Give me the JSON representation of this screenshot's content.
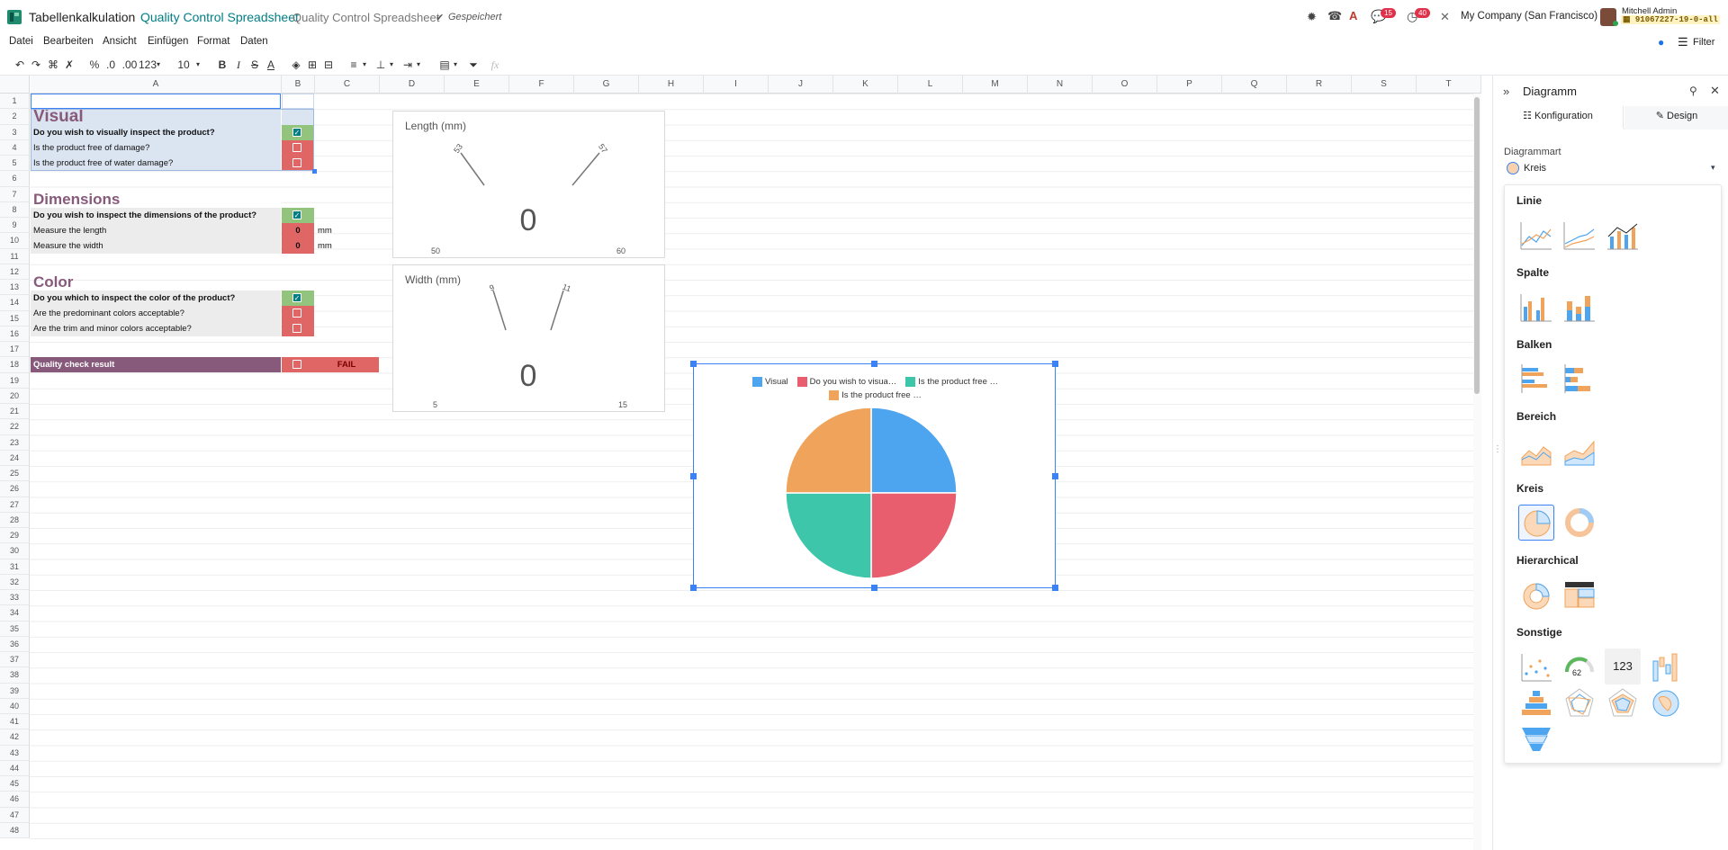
{
  "app": {
    "name": "Tabellenkalkulation",
    "breadcrumb": "Quality Control Spreadsheet",
    "doc_name": "Quality Control Spreadsheet",
    "status": "Gespeichert"
  },
  "systray": {
    "msg_badge": "15",
    "activity_badge": "40",
    "company": "My Company (San Francisco)",
    "user": "Mitchell Admin",
    "db": "91067227-19-0-all"
  },
  "menu": [
    "Datei",
    "Bearbeiten",
    "Ansicht",
    "Einfügen",
    "Format",
    "Daten"
  ],
  "toolbar": {
    "percent": "%",
    "dec_less": ".0",
    "dec_more": ".00",
    "number_format": "123",
    "font_size": "10",
    "fx": "fx",
    "filter": "Filter"
  },
  "columns": [
    "A",
    "B",
    "C",
    "D",
    "E",
    "F",
    "G",
    "H",
    "I",
    "J",
    "K",
    "L",
    "M",
    "N",
    "O",
    "P",
    "Q",
    "R",
    "S",
    "T"
  ],
  "rows": [
    "1",
    "2",
    "3",
    "4",
    "5",
    "6",
    "7",
    "8",
    "9",
    "10",
    "11",
    "12",
    "13",
    "14",
    "15",
    "16",
    "17",
    "18",
    "19",
    "20",
    "21",
    "22",
    "23",
    "24",
    "25",
    "26",
    "27",
    "28",
    "29",
    "30",
    "31",
    "32",
    "33",
    "34",
    "35",
    "36",
    "37",
    "38",
    "39",
    "40",
    "41",
    "42",
    "43",
    "44",
    "45",
    "46",
    "47",
    "48"
  ],
  "sheet": {
    "visual_title": "Visual",
    "q_visual": "Do you wish to visually inspect the product?",
    "q_damage": "Is the product free of damage?",
    "q_water": "Is the product free of water damage?",
    "dim_title": "Dimensions",
    "q_dim": "Do you wish to inspect the dimensions of the product?",
    "length_label": "Measure the length",
    "length_val": "0",
    "length_unit": "mm",
    "width_label": "Measure the width",
    "width_val": "0",
    "width_unit": "mm",
    "color_title": "Color",
    "q_color": "Do you which to inspect the color of the product?",
    "q_pred": "Are the predominant colors acceptable?",
    "q_trim": "Are the trim and minor colors acceptable?",
    "result_label": "Quality check result",
    "result_val": "FAIL"
  },
  "gauge_length": {
    "title": "Length (mm)",
    "value": "0",
    "min": "50",
    "max": "60",
    "lower_mark": "53",
    "upper_mark": "57"
  },
  "gauge_width": {
    "title": "Width (mm)",
    "value": "0",
    "min": "5",
    "max": "15",
    "lower_mark": "9",
    "upper_mark": "11"
  },
  "chart_data": {
    "type": "pie",
    "legend_position": "top",
    "series": [
      {
        "name": "Visual",
        "value": 1,
        "color": "#4ea5ef"
      },
      {
        "name": "Do you wish to visua…",
        "value": 1,
        "color": "#e85e6f"
      },
      {
        "name": "Is the product free …",
        "value": 1,
        "color": "#3ec6aa"
      },
      {
        "name": "Is the product free …",
        "value": 1,
        "color": "#f0a35b"
      }
    ]
  },
  "panel": {
    "title": "Diagramm",
    "tab_config": "Konfiguration",
    "tab_design": "Design",
    "type_label": "Diagrammart",
    "type_value": "Kreis",
    "sections": {
      "line": "Linie",
      "column": "Spalte",
      "bar": "Balken",
      "area": "Bereich",
      "pie": "Kreis",
      "hier": "Hierarchical",
      "other": "Sonstige"
    },
    "gauge_icon_value": "62",
    "scorecard_icon_value": "123"
  },
  "colors": {
    "brand": "#017e84",
    "accent_purple": "#875a7b",
    "green": "#93c47d",
    "red": "#e06666",
    "blue_sel": "#3b82f6"
  }
}
